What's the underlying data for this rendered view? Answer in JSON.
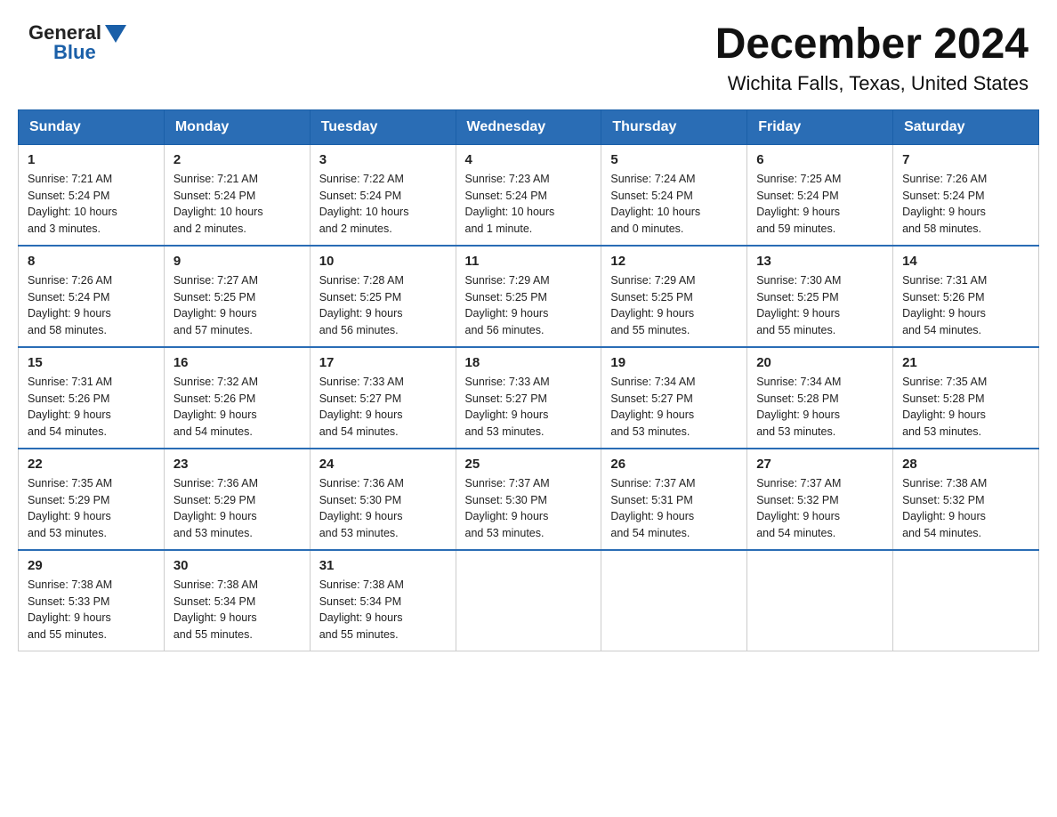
{
  "header": {
    "logo_general": "General",
    "logo_blue": "Blue",
    "title": "December 2024",
    "subtitle": "Wichita Falls, Texas, United States"
  },
  "calendar": {
    "days_of_week": [
      "Sunday",
      "Monday",
      "Tuesday",
      "Wednesday",
      "Thursday",
      "Friday",
      "Saturday"
    ],
    "weeks": [
      [
        {
          "day": "1",
          "info": "Sunrise: 7:21 AM\nSunset: 5:24 PM\nDaylight: 10 hours\nand 3 minutes."
        },
        {
          "day": "2",
          "info": "Sunrise: 7:21 AM\nSunset: 5:24 PM\nDaylight: 10 hours\nand 2 minutes."
        },
        {
          "day": "3",
          "info": "Sunrise: 7:22 AM\nSunset: 5:24 PM\nDaylight: 10 hours\nand 2 minutes."
        },
        {
          "day": "4",
          "info": "Sunrise: 7:23 AM\nSunset: 5:24 PM\nDaylight: 10 hours\nand 1 minute."
        },
        {
          "day": "5",
          "info": "Sunrise: 7:24 AM\nSunset: 5:24 PM\nDaylight: 10 hours\nand 0 minutes."
        },
        {
          "day": "6",
          "info": "Sunrise: 7:25 AM\nSunset: 5:24 PM\nDaylight: 9 hours\nand 59 minutes."
        },
        {
          "day": "7",
          "info": "Sunrise: 7:26 AM\nSunset: 5:24 PM\nDaylight: 9 hours\nand 58 minutes."
        }
      ],
      [
        {
          "day": "8",
          "info": "Sunrise: 7:26 AM\nSunset: 5:24 PM\nDaylight: 9 hours\nand 58 minutes."
        },
        {
          "day": "9",
          "info": "Sunrise: 7:27 AM\nSunset: 5:25 PM\nDaylight: 9 hours\nand 57 minutes."
        },
        {
          "day": "10",
          "info": "Sunrise: 7:28 AM\nSunset: 5:25 PM\nDaylight: 9 hours\nand 56 minutes."
        },
        {
          "day": "11",
          "info": "Sunrise: 7:29 AM\nSunset: 5:25 PM\nDaylight: 9 hours\nand 56 minutes."
        },
        {
          "day": "12",
          "info": "Sunrise: 7:29 AM\nSunset: 5:25 PM\nDaylight: 9 hours\nand 55 minutes."
        },
        {
          "day": "13",
          "info": "Sunrise: 7:30 AM\nSunset: 5:25 PM\nDaylight: 9 hours\nand 55 minutes."
        },
        {
          "day": "14",
          "info": "Sunrise: 7:31 AM\nSunset: 5:26 PM\nDaylight: 9 hours\nand 54 minutes."
        }
      ],
      [
        {
          "day": "15",
          "info": "Sunrise: 7:31 AM\nSunset: 5:26 PM\nDaylight: 9 hours\nand 54 minutes."
        },
        {
          "day": "16",
          "info": "Sunrise: 7:32 AM\nSunset: 5:26 PM\nDaylight: 9 hours\nand 54 minutes."
        },
        {
          "day": "17",
          "info": "Sunrise: 7:33 AM\nSunset: 5:27 PM\nDaylight: 9 hours\nand 54 minutes."
        },
        {
          "day": "18",
          "info": "Sunrise: 7:33 AM\nSunset: 5:27 PM\nDaylight: 9 hours\nand 53 minutes."
        },
        {
          "day": "19",
          "info": "Sunrise: 7:34 AM\nSunset: 5:27 PM\nDaylight: 9 hours\nand 53 minutes."
        },
        {
          "day": "20",
          "info": "Sunrise: 7:34 AM\nSunset: 5:28 PM\nDaylight: 9 hours\nand 53 minutes."
        },
        {
          "day": "21",
          "info": "Sunrise: 7:35 AM\nSunset: 5:28 PM\nDaylight: 9 hours\nand 53 minutes."
        }
      ],
      [
        {
          "day": "22",
          "info": "Sunrise: 7:35 AM\nSunset: 5:29 PM\nDaylight: 9 hours\nand 53 minutes."
        },
        {
          "day": "23",
          "info": "Sunrise: 7:36 AM\nSunset: 5:29 PM\nDaylight: 9 hours\nand 53 minutes."
        },
        {
          "day": "24",
          "info": "Sunrise: 7:36 AM\nSunset: 5:30 PM\nDaylight: 9 hours\nand 53 minutes."
        },
        {
          "day": "25",
          "info": "Sunrise: 7:37 AM\nSunset: 5:30 PM\nDaylight: 9 hours\nand 53 minutes."
        },
        {
          "day": "26",
          "info": "Sunrise: 7:37 AM\nSunset: 5:31 PM\nDaylight: 9 hours\nand 54 minutes."
        },
        {
          "day": "27",
          "info": "Sunrise: 7:37 AM\nSunset: 5:32 PM\nDaylight: 9 hours\nand 54 minutes."
        },
        {
          "day": "28",
          "info": "Sunrise: 7:38 AM\nSunset: 5:32 PM\nDaylight: 9 hours\nand 54 minutes."
        }
      ],
      [
        {
          "day": "29",
          "info": "Sunrise: 7:38 AM\nSunset: 5:33 PM\nDaylight: 9 hours\nand 55 minutes."
        },
        {
          "day": "30",
          "info": "Sunrise: 7:38 AM\nSunset: 5:34 PM\nDaylight: 9 hours\nand 55 minutes."
        },
        {
          "day": "31",
          "info": "Sunrise: 7:38 AM\nSunset: 5:34 PM\nDaylight: 9 hours\nand 55 minutes."
        },
        {
          "day": "",
          "info": ""
        },
        {
          "day": "",
          "info": ""
        },
        {
          "day": "",
          "info": ""
        },
        {
          "day": "",
          "info": ""
        }
      ]
    ]
  }
}
